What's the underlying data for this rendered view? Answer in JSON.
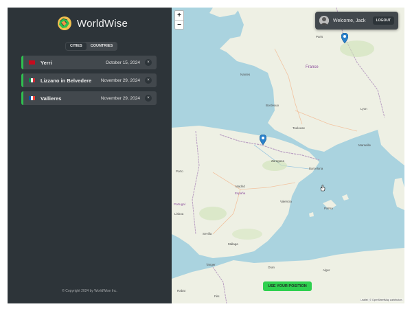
{
  "app": {
    "name": "WorldWise"
  },
  "tabs": [
    {
      "label": "Cities",
      "active": true
    },
    {
      "label": "Countries",
      "active": false
    }
  ],
  "cities": [
    {
      "name": "Yerri",
      "date": "October 15, 2024",
      "flag": "spain-flag"
    },
    {
      "name": "Lizzano in Belvedere",
      "date": "November 29, 2024",
      "flag": "italy-flag"
    },
    {
      "name": "Vallieres",
      "date": "November 29, 2024",
      "flag": "france-flag"
    }
  ],
  "delete_label": "×",
  "footer": "© Copyright 2024 by WorldWise Inc.",
  "map": {
    "zoom_in": "+",
    "zoom_out": "−",
    "user_welcome": "Welcome, Jack",
    "logout_label": "Logout",
    "position_button": "Use your position",
    "attribution": "Leaflet | © OpenStreetMap contributors",
    "labels": [
      "France",
      "Paris",
      "Nantes",
      "Bordeaux",
      "Toulouse",
      "Zaragoza",
      "Barcelona",
      "Madrid",
      "España",
      "Valencia",
      "Sevilla",
      "Málaga",
      "Portugal",
      "Lisboa",
      "Porto",
      "Marseille",
      "Lyon",
      "Alger",
      "Rabat",
      "Fès",
      "Tanger",
      "Palma",
      "Oran"
    ]
  },
  "colors": {
    "accent_green": "#2fbf4f",
    "sidebar_bg": "#2d3439",
    "panel_bg": "#42484d",
    "sea": "#aad3df",
    "land": "#eef0e4"
  }
}
